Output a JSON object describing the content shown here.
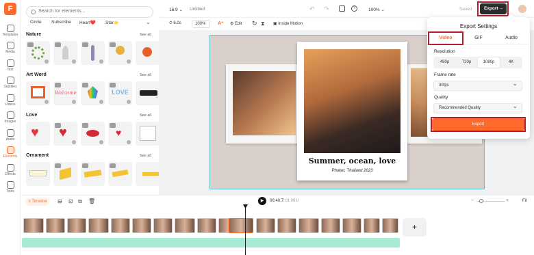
{
  "app": {
    "logo": "F"
  },
  "rail": {
    "items": [
      {
        "label": "Templates"
      },
      {
        "label": "Media"
      },
      {
        "label": "Text"
      },
      {
        "label": "Subtitles"
      },
      {
        "label": "Videos"
      },
      {
        "label": "Images"
      },
      {
        "label": "Audio"
      },
      {
        "label": "Elements"
      },
      {
        "label": "Effects"
      },
      {
        "label": "Tools"
      }
    ]
  },
  "panel": {
    "search_placeholder": "Search for elements...",
    "chips": [
      "Circle",
      "Subscribe",
      "Heart❤️",
      "Star⭐"
    ],
    "sections": [
      {
        "title": "Nature",
        "see_all": "See all"
      },
      {
        "title": "Art Word",
        "see_all": "See all"
      },
      {
        "title": "Love",
        "see_all": "See all"
      },
      {
        "title": "Ornament",
        "see_all": "See all"
      }
    ],
    "art_words": [
      "Welcome",
      "LOVE"
    ]
  },
  "topbar": {
    "ratio": "16:9",
    "title": "Untitled",
    "zoom": "100%",
    "saved": "Saved",
    "export": "Export"
  },
  "toolbar": {
    "duration": "6.0s",
    "scale": "100%",
    "edit": "Edit",
    "inside_motion": "Inside Motion"
  },
  "canvas": {
    "caption": "Summer, ocean, love",
    "subcaption": "Phuket, Thailand 2023"
  },
  "timeline": {
    "label": "Timeline",
    "current": "00:40.7",
    "total": "01:09.0",
    "fit": "Fit",
    "plus": "+"
  },
  "export_dialog": {
    "title": "Export Settings",
    "tabs": [
      "Video",
      "GIF",
      "Audio"
    ],
    "resolution_label": "Resolution",
    "resolutions": [
      "480p",
      "720p",
      "1080p",
      "4K"
    ],
    "selected_resolution": "1080p",
    "framerate_label": "Frame rate",
    "framerate": "30fps",
    "quality_label": "Quality",
    "quality": "Recommended Quality",
    "export_button": "Export"
  },
  "colors": {
    "accent": "#ff6a2b",
    "highlight": "#b3202c",
    "selection": "#5cc6d0"
  }
}
